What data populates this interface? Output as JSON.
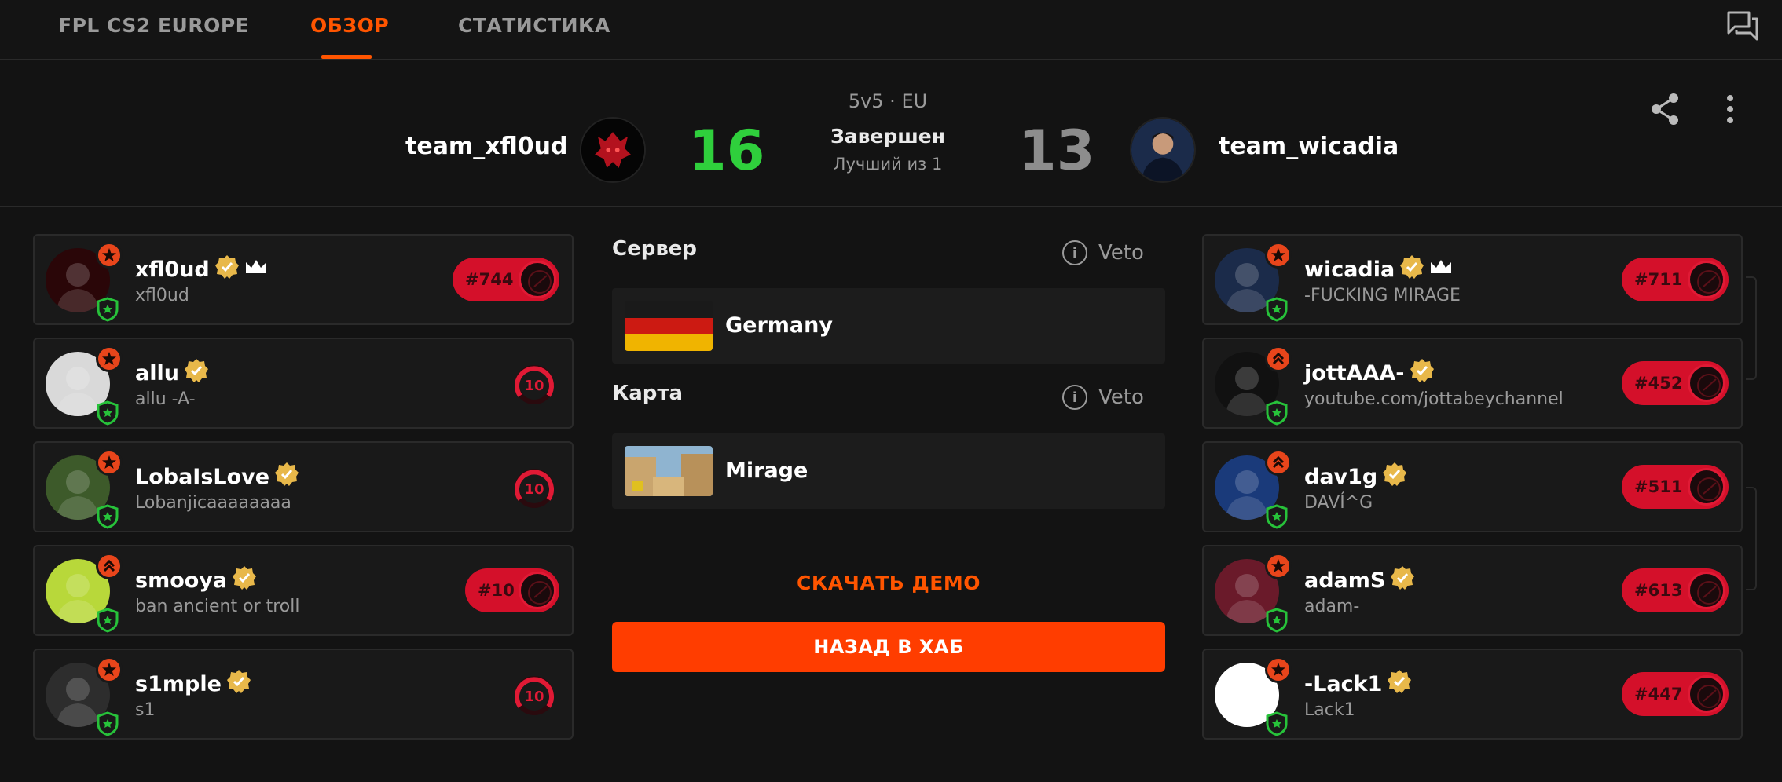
{
  "nav": {
    "tabs": [
      "FPL CS2 EUROPE",
      "ОБЗОР",
      "СТАТИСТИКА"
    ],
    "active_tab": "ОБЗОР",
    "chat_icon": "chat-icon"
  },
  "match": {
    "format": "5v5 · EU",
    "status": "Завершен",
    "best_of": "Лучший из 1",
    "team1": {
      "name": "team_xfl0ud",
      "score": "16"
    },
    "team2": {
      "name": "team_wicadia",
      "score": "13"
    },
    "share_icon": "share-icon",
    "more_icon": "more-vertical-icon"
  },
  "team1_players": [
    {
      "name": "xfl0ud",
      "sub": "xfl0ud",
      "rank": "#744",
      "leader": true,
      "top_badge": "star",
      "level": ""
    },
    {
      "name": "allu",
      "sub": "allu -A-",
      "rank": "",
      "leader": false,
      "top_badge": "star",
      "level": "10"
    },
    {
      "name": "LobaIsLove",
      "sub": "Lobanjicaaaaaaaa",
      "rank": "",
      "leader": false,
      "top_badge": "star",
      "level": "10"
    },
    {
      "name": "smooya",
      "sub": "ban ancient or troll",
      "rank": "#10",
      "leader": false,
      "top_badge": "chevrons",
      "level": ""
    },
    {
      "name": "s1mple",
      "sub": "s1",
      "rank": "",
      "leader": false,
      "top_badge": "star",
      "level": "10"
    }
  ],
  "team2_players": [
    {
      "name": "wicadia",
      "sub": "-FUCKING MIRAGE",
      "rank": "#711",
      "leader": true,
      "top_badge": "star",
      "level": ""
    },
    {
      "name": "jottAAA-",
      "sub": "youtube.com/jottabeychannel",
      "rank": "#452",
      "leader": false,
      "top_badge": "chevrons",
      "level": ""
    },
    {
      "name": "dav1g",
      "sub": "DAVÍ^G",
      "rank": "#511",
      "leader": false,
      "top_badge": "chevrons",
      "level": ""
    },
    {
      "name": "adamS",
      "sub": "adam-",
      "rank": "#613",
      "leader": false,
      "top_badge": "star",
      "level": ""
    },
    {
      "name": "-Lack1",
      "sub": "Lack1",
      "rank": "#447",
      "leader": false,
      "top_badge": "star",
      "level": ""
    }
  ],
  "server": {
    "label": "Сервер",
    "veto": "Veto",
    "value": "Germany"
  },
  "map": {
    "label": "Карта",
    "veto": "Veto",
    "value": "Mirage"
  },
  "actions": {
    "demo": "СКАЧАТЬ ДЕМО",
    "back": "НАЗАД В ХАБ"
  },
  "colors": {
    "accent": "#ff5500",
    "win": "#2fcf3c",
    "rank_red": "#d4102a",
    "verified": "#e8b84a"
  }
}
